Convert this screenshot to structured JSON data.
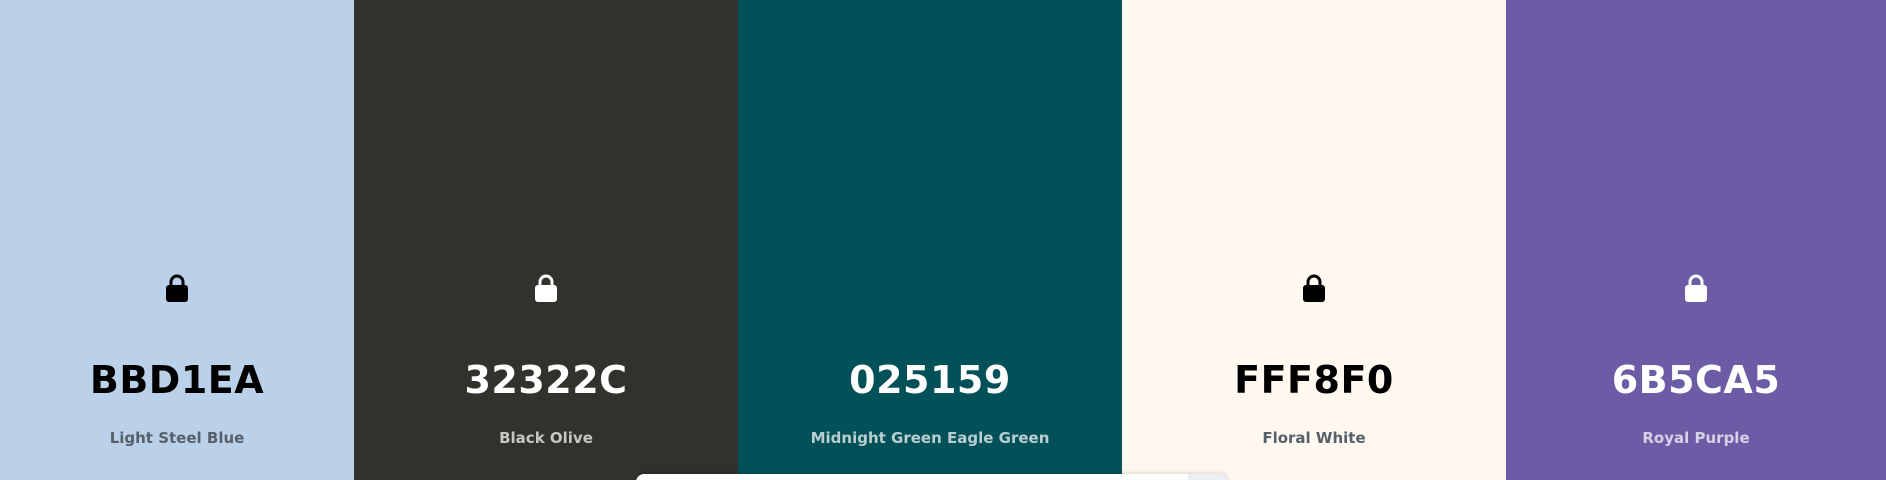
{
  "palette": {
    "colors": [
      {
        "hex": "BBD1EA",
        "name": "Light Steel Blue",
        "bg": "#BBD1EA",
        "text_theme": "dark",
        "locked": true,
        "icon": "lock-icon"
      },
      {
        "hex": "32322C",
        "name": "Black Olive",
        "bg": "#32322C",
        "text_theme": "light",
        "locked": true,
        "icon": "lock-icon"
      },
      {
        "hex": "025159",
        "name": "Midnight Green Eagle Green",
        "bg": "#025159",
        "text_theme": "light",
        "locked": false,
        "icon": null
      },
      {
        "hex": "FFF8F0",
        "name": "Floral White",
        "bg": "#FFF8F0",
        "text_theme": "dark",
        "locked": true,
        "icon": "lock-icon"
      },
      {
        "hex": "6B5CA5",
        "name": "Royal Purple",
        "bg": "#6B5CA5",
        "text_theme": "light",
        "locked": true,
        "icon": "lock-icon"
      }
    ]
  }
}
